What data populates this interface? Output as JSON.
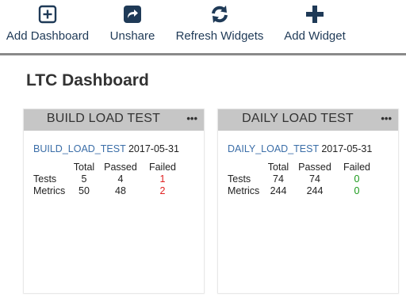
{
  "toolbar": {
    "add_dashboard": "Add Dashboard",
    "unshare": "Unshare",
    "refresh_widgets": "Refresh Widgets",
    "add_widget": "Add Widget",
    "icon_color": "#1f3a57"
  },
  "dashboard": {
    "title": "LTC Dashboard"
  },
  "table_headers": {
    "total": "Total",
    "passed": "Passed",
    "failed": "Failed"
  },
  "widgets": [
    {
      "title": "BUILD LOAD TEST",
      "menu": "•••",
      "link": "BUILD_LOAD_TEST",
      "date": "2017-05-31",
      "rows": [
        {
          "label": "Tests",
          "total": "5",
          "passed": "4",
          "failed": "1",
          "failed_color": "#e02020"
        },
        {
          "label": "Metrics",
          "total": "50",
          "passed": "48",
          "failed": "2",
          "failed_color": "#e02020"
        }
      ]
    },
    {
      "title": "DAILY LOAD TEST",
      "menu": "•••",
      "link": "DAILY_LOAD_TEST",
      "date": "2017-05-31",
      "rows": [
        {
          "label": "Tests",
          "total": "74",
          "passed": "74",
          "failed": "0",
          "failed_color": "#1a9a1a"
        },
        {
          "label": "Metrics",
          "total": "244",
          "passed": "244",
          "failed": "0",
          "failed_color": "#1a9a1a"
        }
      ]
    }
  ]
}
